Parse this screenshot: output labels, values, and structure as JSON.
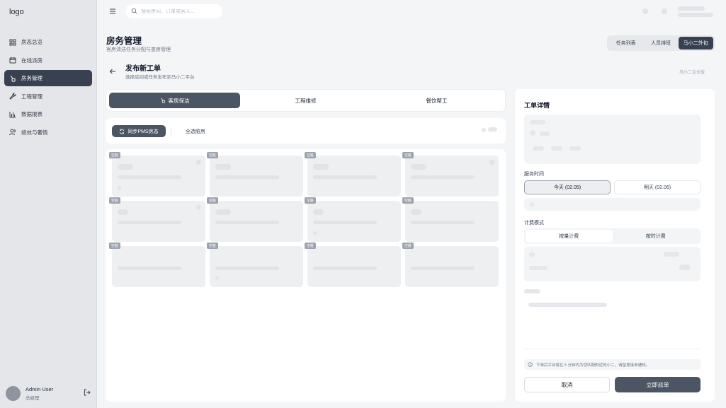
{
  "app": {
    "logo": "logo"
  },
  "sidebar": {
    "items": [
      {
        "label": "房态总览",
        "icon": "grid-icon",
        "active": false
      },
      {
        "label": "在线派房",
        "icon": "calendar-icon",
        "active": false
      },
      {
        "label": "房务管理",
        "icon": "broom-icon",
        "active": true
      },
      {
        "label": "工程管理",
        "icon": "wrench-icon",
        "active": false
      },
      {
        "label": "数据报表",
        "icon": "bar-chart-icon",
        "active": false
      },
      {
        "label": "绩效与奢情",
        "icon": "users-icon",
        "active": false
      }
    ],
    "user": {
      "name": "Admin User",
      "role": "总经理"
    }
  },
  "topbar": {
    "search_placeholder": "搜索房间、订单或客人..."
  },
  "page": {
    "title": "房务管理",
    "subtitle": "客房清洁任务分配与查房管理",
    "tabs": [
      {
        "label": "任务列表",
        "active": false
      },
      {
        "label": "人员排班",
        "active": false
      },
      {
        "label": "马小二外包",
        "active": true
      }
    ]
  },
  "order": {
    "title": "发布新工单",
    "desc": "选择房间或任务发布到马小二平台",
    "company": "马小二企业版",
    "categories": [
      {
        "label": "客房保洁",
        "active": true
      },
      {
        "label": "工程维修",
        "active": false
      },
      {
        "label": "餐饮帮工",
        "active": false
      }
    ],
    "sync_label": "同步PMS房态",
    "select_all_label": "全选脏房",
    "room_tag": "空脏"
  },
  "detail": {
    "title": "工单详情",
    "service_time_label": "服务时间",
    "days": [
      {
        "label": "今天 (02.05)",
        "active": true
      },
      {
        "label": "明天 (02.06)",
        "active": false
      }
    ],
    "billing_label": "计费模式",
    "billing": [
      {
        "label": "按量计费",
        "active": true
      },
      {
        "label": "按时计费",
        "active": false
      }
    ],
    "notice": "下单后平台将在 5 分钟内为您匹配附近的小二，请留意接单通知。",
    "cancel_label": "取消",
    "submit_label": "立即派单"
  },
  "colors": {
    "accent": "#374151",
    "button": "#4b5563",
    "sidebar_bg": "#e4e6ea"
  }
}
